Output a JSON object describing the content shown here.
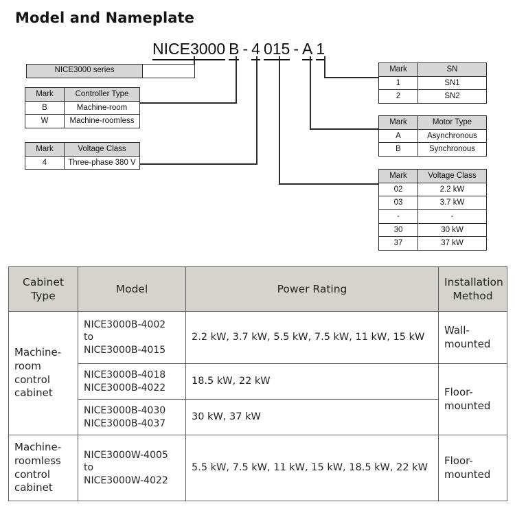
{
  "title": "Model and Nameplate",
  "model_code": {
    "segments": [
      {
        "text": "NICE3000",
        "underline": true,
        "name": "code-series"
      },
      {
        "text": "B",
        "underline": true,
        "name": "code-controller-type"
      },
      {
        "text": "-",
        "underline": false,
        "name": "code-dash-1"
      },
      {
        "text": "4",
        "underline": true,
        "name": "code-voltage-class"
      },
      {
        "text": "015",
        "underline": true,
        "name": "code-power"
      },
      {
        "text": "-",
        "underline": false,
        "name": "code-dash-2"
      },
      {
        "text": "A",
        "underline": true,
        "name": "code-motor-type"
      },
      {
        "text": "1",
        "underline": true,
        "name": "code-sn"
      }
    ]
  },
  "series_banner": {
    "label": "NICE3000 series"
  },
  "legends": {
    "controller_type": {
      "headers": [
        "Mark",
        "Controller Type"
      ],
      "rows": [
        [
          "B",
          "Machine-room"
        ],
        [
          "W",
          "Machine-roomless"
        ]
      ]
    },
    "voltage_class_left": {
      "headers": [
        "Mark",
        "Voltage Class"
      ],
      "rows": [
        [
          "4",
          "Three-phase 380 V"
        ]
      ]
    },
    "sn": {
      "headers": [
        "Mark",
        "SN"
      ],
      "rows": [
        [
          "1",
          "SN1"
        ],
        [
          "2",
          "SN2"
        ]
      ]
    },
    "motor_type": {
      "headers": [
        "Mark",
        "Motor Type"
      ],
      "rows": [
        [
          "A",
          "Asynchronous"
        ],
        [
          "B",
          "Synchronous"
        ]
      ]
    },
    "power_class": {
      "headers": [
        "Mark",
        "Voltage Class"
      ],
      "rows": [
        [
          "02",
          "2.2 kW"
        ],
        [
          "03",
          "3.7 kW"
        ],
        [
          "-",
          "-"
        ],
        [
          "30",
          "30 kW"
        ],
        [
          "37",
          "37 kW"
        ]
      ]
    }
  },
  "spec_table": {
    "headers": [
      "Cabinet\nType",
      "Model",
      "Power Rating",
      "Installation\nMethod"
    ],
    "rows": [
      {
        "cabinet_type": "Machine-\nroom\ncontrol\ncabinet",
        "model": "NICE3000B-4002\nto\nNICE3000B-4015",
        "power": "2.2 kW, 3.7 kW, 5.5 kW, 7.5 kW, 11 kW, 15 kW",
        "install": "Wall-\nmounted"
      },
      {
        "model": "NICE3000B-4018\nNICE3000B-4022",
        "power": "18.5 kW, 22 kW",
        "install": "Floor-\nmounted"
      },
      {
        "model": "NICE3000B-4030\nNICE3000B-4037",
        "power": "30 kW, 37 kW"
      },
      {
        "cabinet_type": "Machine-\nroomless\ncontrol\ncabinet",
        "model": "NICE3000W-4005\nto\nNICE3000W-4022",
        "power": "5.5 kW, 7.5 kW, 11 kW, 15 kW, 18.5 kW, 22 kW",
        "install": "Floor-\nmounted"
      }
    ]
  },
  "colors": {
    "header_gray": "#d5d3cb",
    "legend_header_gray": "#d6d6d6",
    "line": "#2b2b2b",
    "text": "#1a1a1a"
  }
}
